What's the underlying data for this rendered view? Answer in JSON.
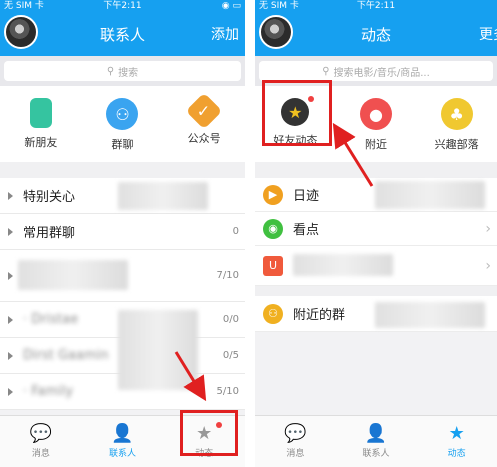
{
  "left": {
    "status": {
      "carrier": "无 SIM 卡 ",
      "time": "下午2:11"
    },
    "header": {
      "title": "联系人",
      "action": "添加"
    },
    "search": {
      "placeholder": "搜索"
    },
    "quick": [
      {
        "label": "新朋友",
        "color": "#35c4a0"
      },
      {
        "label": "群聊",
        "color": "#3aa4f0"
      },
      {
        "label": "公众号",
        "color": "#f0a030"
      }
    ],
    "groups": [
      {
        "label": "特别关心",
        "count": ""
      },
      {
        "label": "常用群聊",
        "count": "0"
      },
      {
        "label": "",
        "count": "7/10"
      },
      {
        "label": "",
        "count": "0/0"
      },
      {
        "label": "",
        "count": "0/5"
      },
      {
        "label": "",
        "count": "5/10"
      }
    ],
    "tabs": [
      {
        "label": "消息",
        "icon": "message-icon"
      },
      {
        "label": "联系人",
        "icon": "contacts-icon"
      },
      {
        "label": "动态",
        "icon": "star-icon"
      }
    ]
  },
  "right": {
    "status": {
      "carrier": "无 SIM 卡 ",
      "time": "下午2:11"
    },
    "header": {
      "title": "动态",
      "action": "更多"
    },
    "search": {
      "placeholder": "搜索电影/音乐/商品..."
    },
    "quick": [
      {
        "label": "好友动态",
        "color": "#f0c020"
      },
      {
        "label": "附近",
        "color": "#f05050"
      },
      {
        "label": "兴趣部落",
        "color": "#f0c830"
      }
    ],
    "features": [
      {
        "label": "日迹",
        "color": "#f0a020"
      },
      {
        "label": "看点",
        "color": "#40c040"
      },
      {
        "label": "",
        "color": "#f05a3c"
      },
      {
        "label": "附近的群",
        "color": "#f0b020"
      }
    ],
    "tabs": [
      {
        "label": "消息",
        "icon": "message-icon"
      },
      {
        "label": "联系人",
        "icon": "contacts-icon"
      },
      {
        "label": "动态",
        "icon": "star-icon"
      }
    ]
  }
}
